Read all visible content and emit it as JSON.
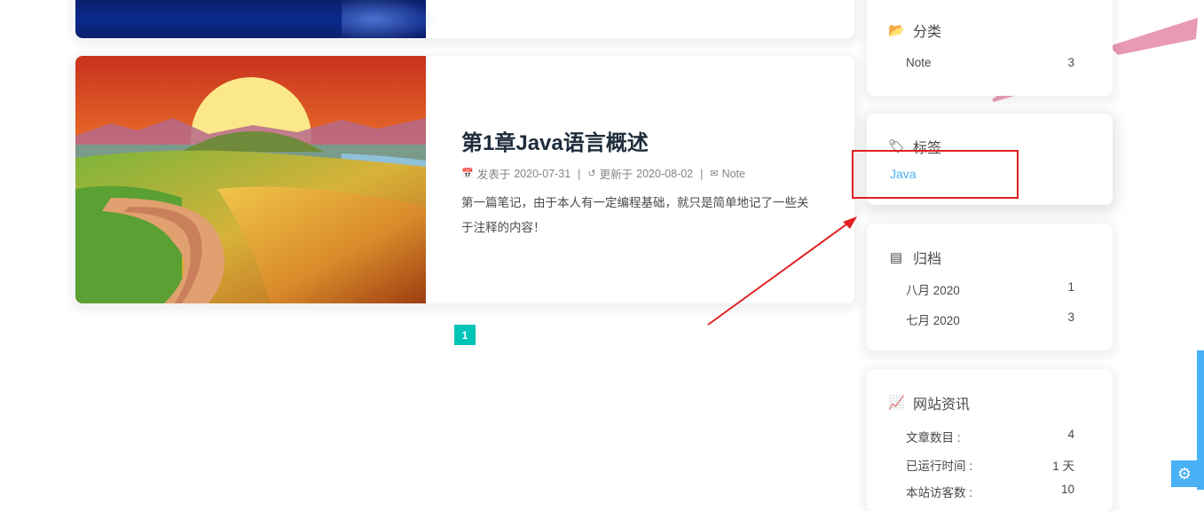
{
  "posts": [
    {
      "title": "第1章Java语言概述",
      "published_label": "发表于",
      "published_date": "2020-07-31",
      "updated_label": "更新于",
      "updated_date": "2020-08-02",
      "category": "Note",
      "excerpt": "第一篇笔记，由于本人有一定编程基础，就只是简单地记了一些关于注释的内容！"
    }
  ],
  "pagination": {
    "current": "1"
  },
  "sidebar": {
    "categories": {
      "title": "分类",
      "items": [
        {
          "name": "Note",
          "count": "3"
        }
      ]
    },
    "tags": {
      "title": "标签",
      "items": [
        "Java"
      ]
    },
    "archives": {
      "title": "归档",
      "items": [
        {
          "name": "八月 2020",
          "count": "1"
        },
        {
          "name": "七月 2020",
          "count": "3"
        }
      ]
    },
    "site_info": {
      "title": "网站资讯",
      "items": [
        {
          "name": "文章数目 :",
          "value": "4"
        },
        {
          "name": "已运行时间 :",
          "value": "1 天"
        },
        {
          "name": "本站访客数 :",
          "value": "10"
        }
      ]
    }
  },
  "colors": {
    "accent": "#49b1f5",
    "pager": "#00c4b6",
    "annotation": "#e02020"
  },
  "icons": [
    "folder-open-icon",
    "tags-icon",
    "archive-icon",
    "chart-line-icon",
    "calendar-icon",
    "history-icon",
    "inbox-icon",
    "gear-icon"
  ]
}
